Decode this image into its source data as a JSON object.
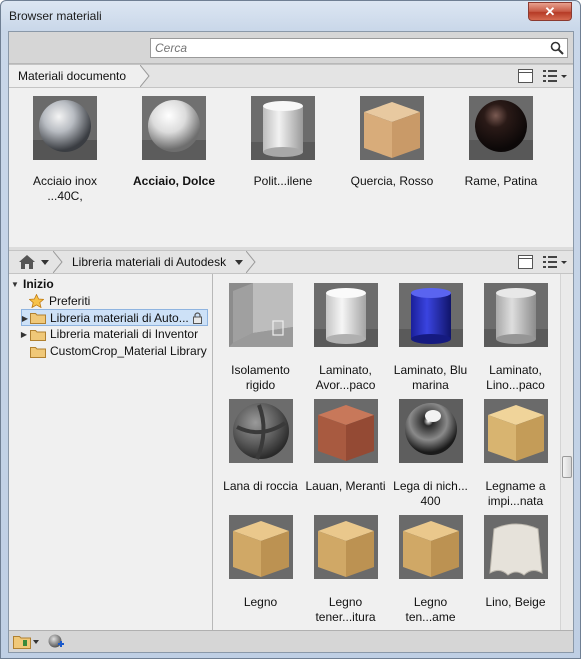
{
  "window": {
    "title": "Browser materiali"
  },
  "search": {
    "placeholder": "Cerca"
  },
  "doc_section": {
    "crumb": "Materiali documento"
  },
  "doc_materials": [
    {
      "label": "Acciaio inox ...40C,",
      "bold": false,
      "material": "steel-sphere"
    },
    {
      "label": "Acciaio, Dolce",
      "bold": true,
      "material": "white-sphere"
    },
    {
      "label": "Polit...ilene",
      "bold": false,
      "material": "white-cylinder"
    },
    {
      "label": "Quercia, Rosso",
      "bold": false,
      "material": "oak-cube"
    },
    {
      "label": "Rame, Patina",
      "bold": false,
      "material": "dark-sphere"
    }
  ],
  "library_section": {
    "crumb": "Libreria materiali di Autodesk"
  },
  "tree": {
    "root": "Inizio",
    "items": [
      {
        "label": "Preferiti",
        "icon": "star-icon"
      },
      {
        "label": "Libreria materiali di Auto...",
        "icon": "folder-icon",
        "selected": true,
        "locked": true
      },
      {
        "label": "Libreria materiali di Inventor",
        "icon": "folder-icon"
      },
      {
        "label": "CustomCrop_Material Library",
        "icon": "folder-icon"
      }
    ]
  },
  "library_materials": [
    {
      "label": "Isolamento rigido",
      "material": "insulation"
    },
    {
      "label": "Laminato, Avor...paco",
      "material": "white-cylinder"
    },
    {
      "label": "Laminato, Blu marina",
      "material": "blue-cylinder"
    },
    {
      "label": "Laminato, Lino...paco",
      "material": "grey-cylinder"
    },
    {
      "label": "Lana di roccia",
      "material": "rock-sphere"
    },
    {
      "label": "Lauan, Meranti",
      "material": "red-wood-cube"
    },
    {
      "label": "Lega di nich... 400",
      "material": "chrome-sphere"
    },
    {
      "label": "Legname a impi...nata",
      "material": "plywood-cube"
    },
    {
      "label": "Legno",
      "material": "light-wood-cube"
    },
    {
      "label": "Legno tener...itura",
      "material": "light-wood-cube"
    },
    {
      "label": "Legno ten...ame",
      "material": "light-wood-cube"
    },
    {
      "label": "Lino, Beige",
      "material": "cloth"
    }
  ]
}
